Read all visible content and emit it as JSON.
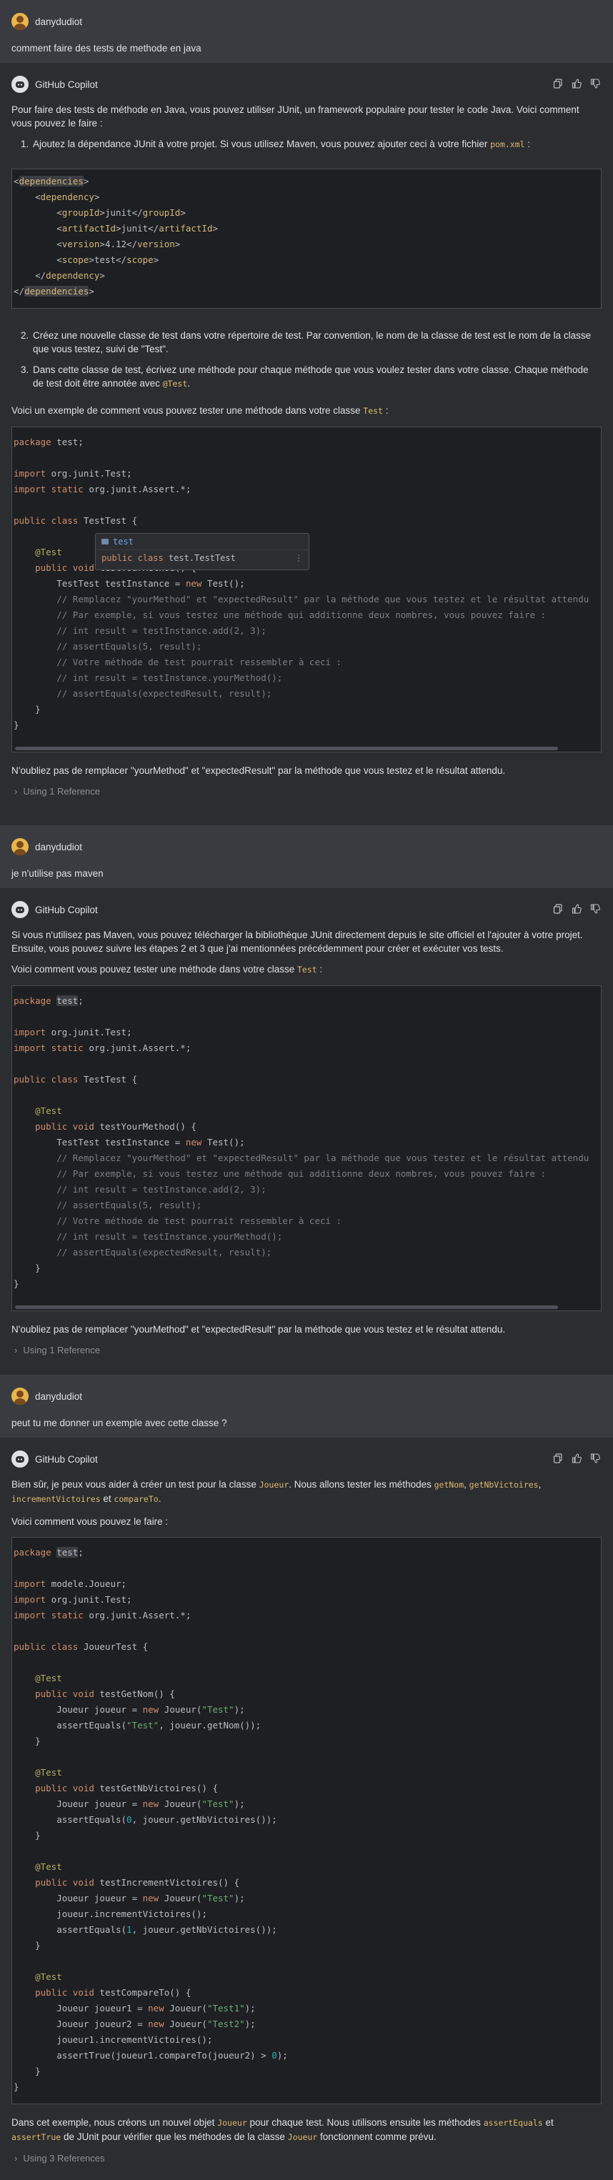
{
  "conversation": {
    "user_name": "danydudiot",
    "bot_name": "GitHub Copilot",
    "messages": {
      "u1": "comment faire des tests de methode en java",
      "u2": "je n'utilise pas maven",
      "u3": "peut tu me donner un exemple avec cette classe ?"
    },
    "b1": {
      "intro": "Pour faire des tests de méthode en Java, vous pouvez utiliser JUnit, un framework populaire pour tester le code Java. Voici comment vous pouvez le faire :",
      "step1": "Ajoutez la dépendance JUnit à votre projet. Si vous utilisez Maven, vous pouvez ajouter ceci à votre fichier ",
      "step1_code": "pom.xml",
      "step1_end": " :",
      "step2": "Créez une nouvelle classe de test dans votre répertoire de test. Par convention, le nom de la classe de test est le nom de la classe que vous testez, suivi de \"Test\".",
      "step3": "Dans cette classe de test, écrivez une méthode pour chaque méthode que vous voulez tester dans votre classe. Chaque méthode de test doit être annotée avec ",
      "step3_code": "@Test",
      "step3_end": ".",
      "example_intro": "Voici un exemple de comment vous pouvez tester une méthode dans votre classe ",
      "example_code": "Test",
      "example_end": " :",
      "outro": "N'oubliez pas de remplacer \"yourMethod\" et \"expectedResult\" par la méthode que vous testez et le résultat attendu.",
      "reference": "Using 1 Reference",
      "popup_title": "test",
      "popup_kw": "public class",
      "popup_name": " test.TestTest"
    },
    "b2": {
      "intro": "Si vous n'utilisez pas Maven, vous pouvez télécharger la bibliothèque JUnit directement depuis le site officiel et l'ajouter à votre projet. Ensuite, vous pouvez suivre les étapes 2 et 3 que j'ai mentionnées précédemment pour créer et exécuter vos tests.",
      "example_intro": "Voici comment vous pouvez tester une méthode dans votre classe ",
      "example_code": "Test",
      "example_end": " :",
      "outro": "N'oubliez pas de remplacer \"yourMethod\" et \"expectedResult\" par la méthode que vous testez et le résultat attendu.",
      "reference": "Using 1 Reference"
    },
    "b3": {
      "intro_a": "Bien sûr, je peux vous aider à créer un test pour la classe ",
      "intro_code1": "Joueur",
      "intro_b": ". Nous allons tester les méthodes ",
      "intro_code2": "getNom",
      "intro_c": ", ",
      "intro_code3": "getNbVictoires",
      "intro_d": ", ",
      "intro_code4": "incrementVictoires",
      "intro_e": " et ",
      "intro_code5": "compareTo",
      "intro_f": ".",
      "how": "Voici comment vous pouvez le faire :",
      "outro_a": "Dans cet exemple, nous créons un nouvel objet ",
      "outro_code1": "Joueur",
      "outro_b": " pour chaque test. Nous utilisons ensuite les méthodes ",
      "outro_code2": "assertEquals",
      "outro_c": " et ",
      "outro_code3": "assertTrue",
      "outro_d": " de JUnit pour vérifier que les méthodes de la classe ",
      "outro_code4": "Joueur",
      "outro_e": " fonctionnent comme prévu.",
      "reference": "Using 3 References"
    }
  }
}
